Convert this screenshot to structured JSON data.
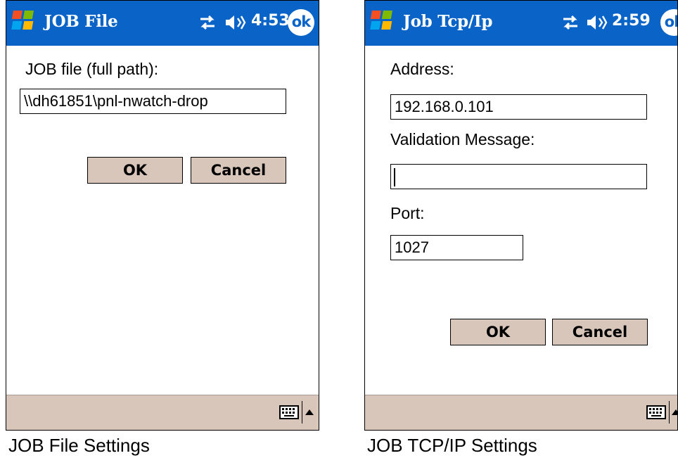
{
  "screens": {
    "job_file": {
      "title": "JOB File",
      "time": "4:53",
      "ok_badge": "ok",
      "field_label": "JOB file (full path):",
      "field_value": "\\\\dh61851\\pnl-nwatch-drop",
      "ok_button": "OK",
      "cancel_button": "Cancel"
    },
    "job_tcpip": {
      "title": "Job Tcp/Ip",
      "time": "2:59",
      "ok_badge": "ok",
      "address_label": "Address:",
      "address_value": "192.168.0.101",
      "validation_label": "Validation Message:",
      "validation_value": "",
      "port_label": "Port:",
      "port_value": "1027",
      "ok_button": "OK",
      "cancel_button": "Cancel"
    }
  },
  "captions": {
    "left": "JOB File Settings",
    "right": "JOB TCP/IP Settings"
  },
  "colors": {
    "titlebar": "#0a64c8",
    "button_face": "#d8c6bb",
    "bottom_bar": "#d8c6bb"
  },
  "icons": [
    "windows-start-icon",
    "connectivity-icon",
    "speaker-icon",
    "ok-close-icon",
    "keyboard-icon",
    "input-menu-arrow-icon"
  ]
}
